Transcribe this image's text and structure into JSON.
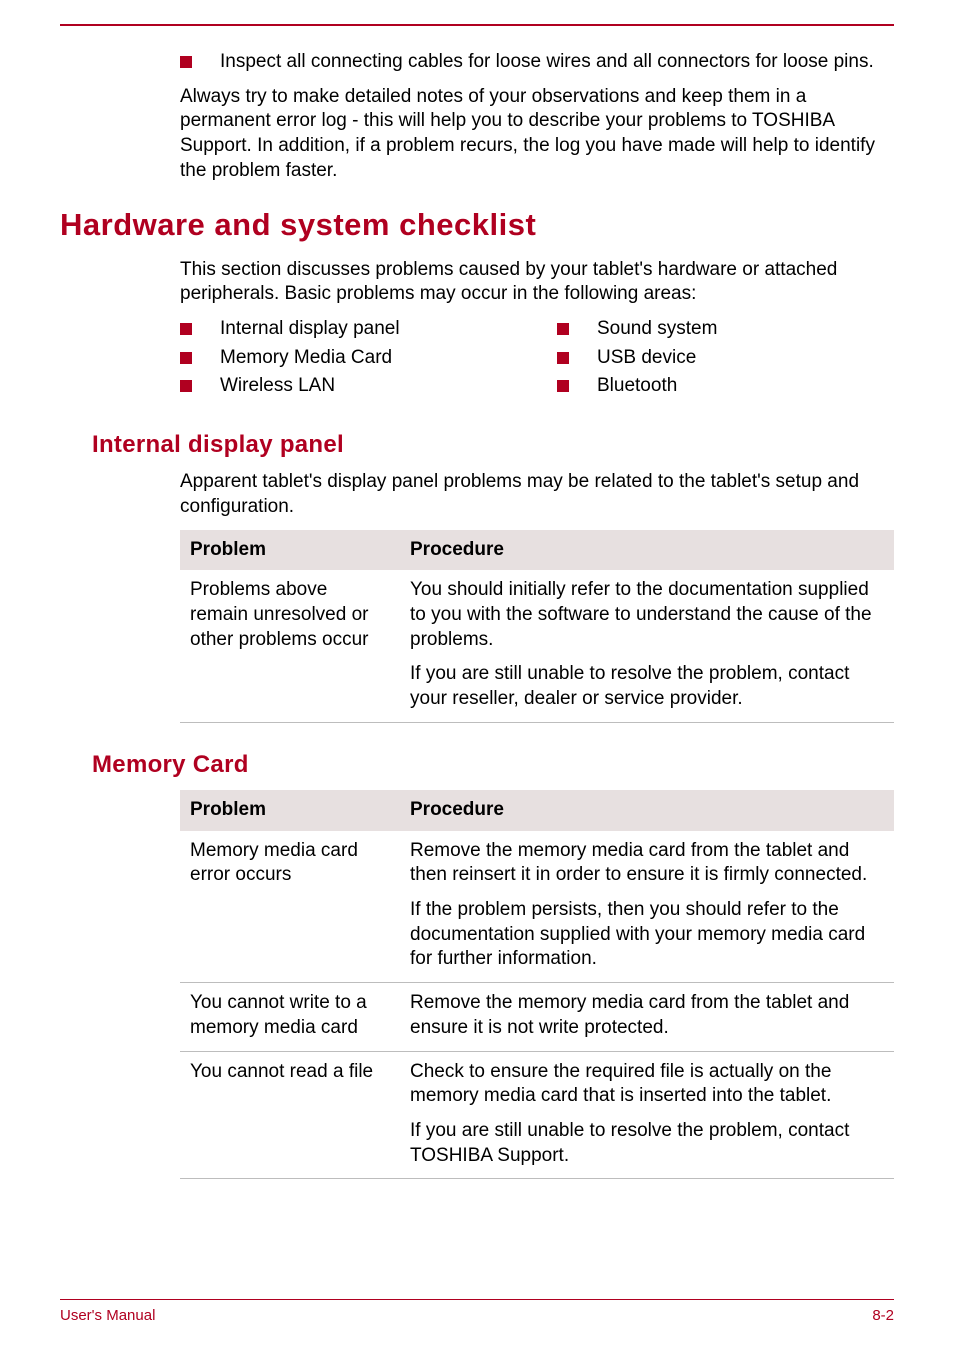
{
  "intro": {
    "bullet": "Inspect all connecting cables for loose wires and all connectors for loose pins.",
    "paragraph": "Always try to make detailed notes of your observations and keep them in a permanent error log - this will help you to describe your problems to TOSHIBA Support. In addition, if a problem recurs, the log you have made will help to identify the problem faster."
  },
  "hardware_section": {
    "title": "Hardware and system checklist",
    "intro": "This section discusses problems caused by your tablet's hardware or attached peripherals. Basic problems may occur in the following areas:",
    "left_bullets": [
      "Internal display panel",
      "Memory Media Card",
      "Wireless LAN"
    ],
    "right_bullets": [
      "Sound system",
      "USB device",
      "Bluetooth"
    ]
  },
  "internal_display": {
    "title": "Internal display panel",
    "intro": "Apparent tablet's display panel problems may be related to the tablet's setup and configuration.",
    "table": {
      "headers": [
        "Problem",
        "Procedure"
      ],
      "rows": [
        {
          "problem": "Problems above remain unresolved or other problems occur",
          "procedure": [
            "You should initially refer to the documentation supplied to you with the software to understand the cause of the problems.",
            "If you are still unable to resolve the problem, contact your reseller, dealer or service provider."
          ]
        }
      ]
    }
  },
  "memory_card": {
    "title": "Memory Card",
    "table": {
      "headers": [
        "Problem",
        "Procedure"
      ],
      "rows": [
        {
          "problem": "Memory media card error occurs",
          "procedure": [
            "Remove the memory media card from the tablet and then reinsert it in order to ensure it is firmly connected.",
            "If the problem persists, then you should refer to the documentation supplied with your memory media card for further information."
          ]
        },
        {
          "problem": "You cannot write to a memory media card",
          "procedure": [
            "Remove the memory media card from the tablet and ensure it is not write protected."
          ]
        },
        {
          "problem": "You cannot read a file",
          "procedure": [
            "Check to ensure the required file is actually on the memory media card that is inserted into the tablet.",
            "If you are still unable to resolve the problem, contact TOSHIBA Support."
          ]
        }
      ]
    }
  },
  "footer": {
    "left": "User's Manual",
    "right": "8-2"
  }
}
